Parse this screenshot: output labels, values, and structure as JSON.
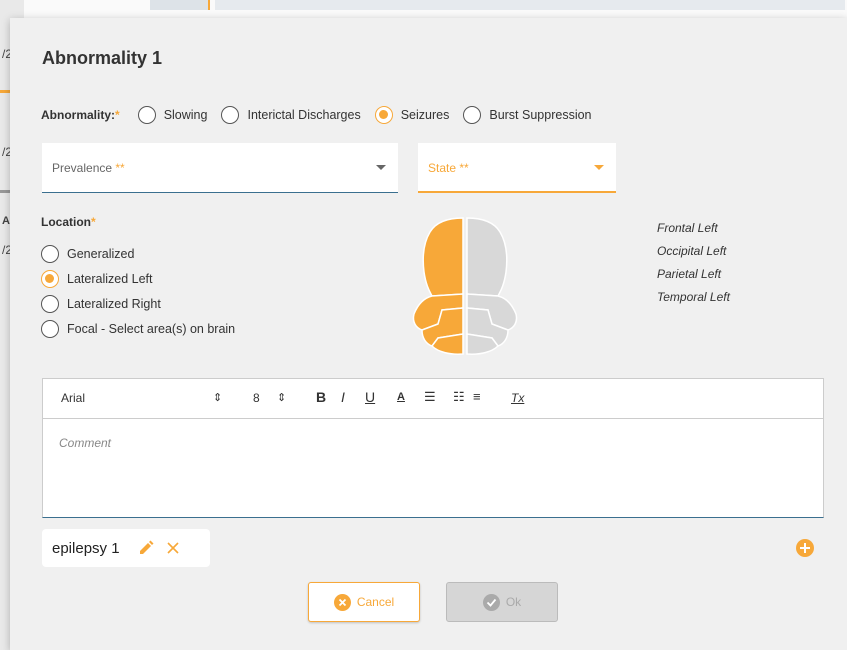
{
  "background": {
    "fragments": [
      "/2",
      "/2",
      "AK",
      "/2"
    ]
  },
  "dialog": {
    "title": "Abnormality 1",
    "abnormality": {
      "label": "Abnormality:",
      "required_mark": "*",
      "options": [
        "Slowing",
        "Interictal Discharges",
        "Seizures",
        "Burst Suppression"
      ],
      "selected": "Seizures"
    },
    "prevalence": {
      "placeholder": "Prevalence",
      "required_mark": "**"
    },
    "state": {
      "placeholder": "State",
      "required_mark": "**"
    },
    "location": {
      "label": "Location",
      "required_mark": "*",
      "options": [
        "Generalized",
        "Lateralized Left",
        "Lateralized Right",
        "Focal - Select area(s) on brain"
      ],
      "selected": "Lateralized Left"
    },
    "selected_areas": [
      "Frontal Left",
      "Occipital Left",
      "Parietal Left",
      "Temporal Left"
    ],
    "editor": {
      "font": "Arial",
      "font_size": "8",
      "comment_placeholder": "Comment"
    },
    "chip": {
      "label": "epilepsy 1"
    },
    "buttons": {
      "cancel": "Cancel",
      "ok": "Ok"
    }
  },
  "colors": {
    "accent": "#f7a839",
    "brain_selected": "#f7a839",
    "brain_unselected": "#d8d8d8",
    "ok_disabled": "#d6d6d6"
  }
}
